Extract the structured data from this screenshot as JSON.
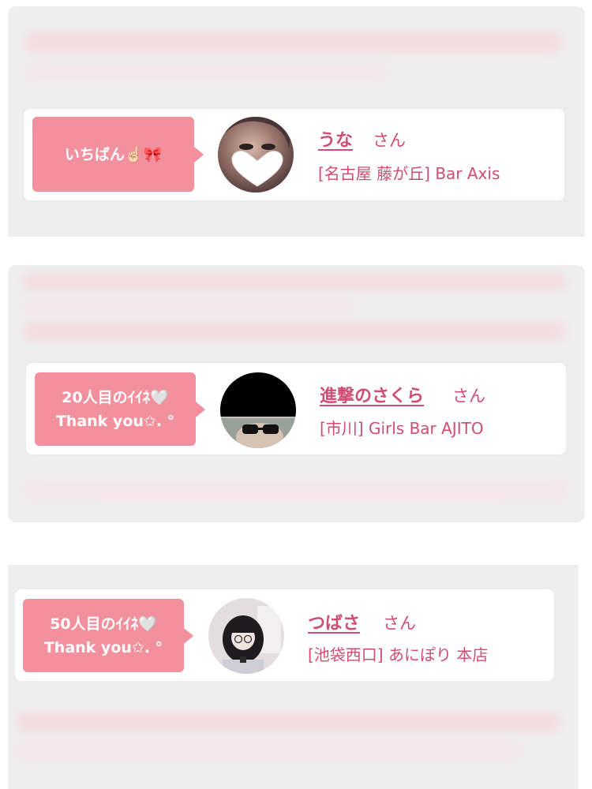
{
  "cards": [
    {
      "message_lines": [
        "いちばん☝🏻🎀"
      ],
      "name": "うな",
      "honorific": "さん",
      "shop": "[名古屋 藤が丘] Bar Axis",
      "avatar_icon": "heart-sticker"
    },
    {
      "message_lines": [
        "20人目のｲｲﾈ🤍",
        "Thank you✩. °"
      ],
      "name": "進撃のさくら",
      "honorific": "さん",
      "shop": "[市川] Girls Bar AJITO",
      "avatar_icon": "sunglasses-photo"
    },
    {
      "message_lines": [
        "50人目のｲｲﾈ🤍",
        "Thank you✩. °"
      ],
      "name": "つばさ",
      "honorific": "さん",
      "shop": "[池袋西口] あにぽり 本店",
      "avatar_icon": "person-photo"
    }
  ],
  "colors": {
    "accent_pink": "#cf4d73",
    "bubble_pink": "#f3909d",
    "panel_gray": "#efeeee"
  }
}
